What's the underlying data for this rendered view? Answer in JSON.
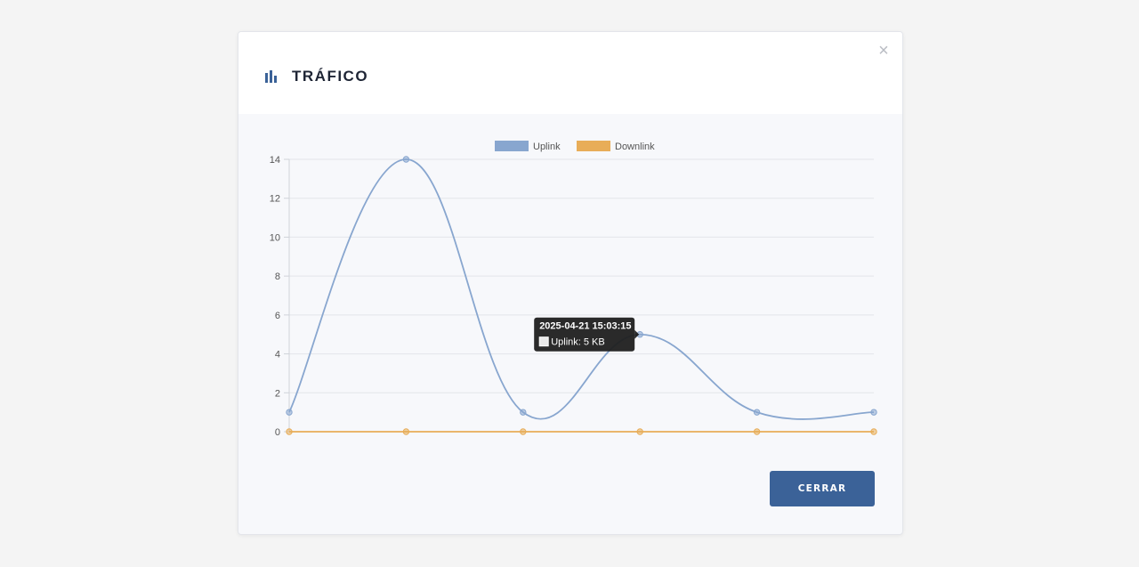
{
  "modal": {
    "title": "TRÁFICO",
    "close_symbol": "×",
    "close_button_label": "CERRAR",
    "title_icon": "bar-chart-icon",
    "close_icon": "close-icon"
  },
  "colors": {
    "uplink": "#88a6cf",
    "downlink": "#e8ad58",
    "button": "#3b6298",
    "tooltip_bg": "#1f1f1f"
  },
  "chart_data": {
    "type": "line",
    "title": "",
    "xlabel": "",
    "ylabel": "",
    "ylim": [
      0,
      14
    ],
    "yticks": [
      0,
      2,
      4,
      6,
      8,
      10,
      12,
      14
    ],
    "grid": true,
    "legend_position": "top-center",
    "series": [
      {
        "name": "Uplink",
        "values": [
          1,
          14,
          1,
          5,
          1,
          1
        ]
      },
      {
        "name": "Downlink",
        "values": [
          0,
          0,
          0,
          0,
          0,
          0
        ]
      }
    ],
    "tooltip": {
      "title": "2025-04-21 15:03:15",
      "label": "Uplink: 5 KB",
      "series_index": 0,
      "point_index": 3
    }
  }
}
